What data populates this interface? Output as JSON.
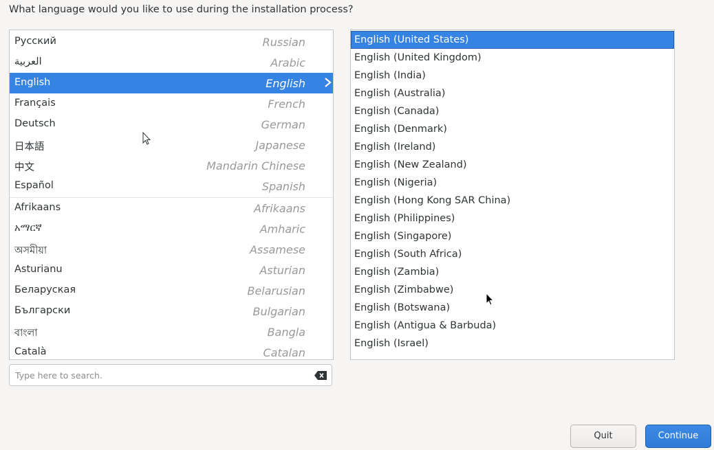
{
  "prompt": "What language would you like to use during the installation process?",
  "languages": [
    {
      "native": "Русский",
      "english": "Russian"
    },
    {
      "native": "العربية",
      "english": "Arabic"
    },
    {
      "native": "English",
      "english": "English",
      "selected": true
    },
    {
      "native": "Français",
      "english": "French"
    },
    {
      "native": "Deutsch",
      "english": "German"
    },
    {
      "native": "日本語",
      "english": "Japanese"
    },
    {
      "native": "中文",
      "english": "Mandarin Chinese"
    },
    {
      "native": "Español",
      "english": "Spanish"
    },
    {
      "native": "Afrikaans",
      "english": "Afrikaans"
    },
    {
      "native": "አማርኛ",
      "english": "Amharic"
    },
    {
      "native": "অসমীয়া",
      "english": "Assamese"
    },
    {
      "native": "Asturianu",
      "english": "Asturian"
    },
    {
      "native": "Беларуская",
      "english": "Belarusian"
    },
    {
      "native": "Български",
      "english": "Bulgarian"
    },
    {
      "native": "বাংলা",
      "english": "Bangla"
    },
    {
      "native": "Català",
      "english": "Catalan"
    }
  ],
  "search": {
    "placeholder": "Type here to search."
  },
  "locales": [
    "English (United States)",
    "English (United Kingdom)",
    "English (India)",
    "English (Australia)",
    "English (Canada)",
    "English (Denmark)",
    "English (Ireland)",
    "English (New Zealand)",
    "English (Nigeria)",
    "English (Hong Kong SAR China)",
    "English (Philippines)",
    "English (Singapore)",
    "English (South Africa)",
    "English (Zambia)",
    "English (Zimbabwe)",
    "English (Botswana)",
    "English (Antigua & Barbuda)",
    "English (Israel)"
  ],
  "selected_locale_index": 0,
  "buttons": {
    "quit": "Quit",
    "continue": "Continue"
  },
  "colors": {
    "accent": "#3584e4"
  }
}
